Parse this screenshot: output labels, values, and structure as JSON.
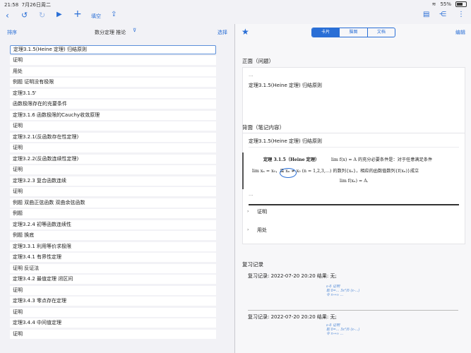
{
  "status": {
    "time": "21:58",
    "date": "7月26日周二",
    "battery": "55%"
  },
  "toolbar": {
    "fill_label": "填空"
  },
  "list_header": {
    "sort": "排序",
    "middle": "数分定理 推论",
    "select": "选择"
  },
  "list_items": [
    "定理3.1.5(Heine 定理) 归结原则",
    "证明",
    "用处",
    "例题 证明没有极限",
    "定理3.1.5'",
    "函数极限存在的充要条件",
    "定理3.1.6 函数极限的Cauchy收敛原理",
    "证明",
    "定理3.2.1(反函数存在性定理)",
    "证明",
    "定理3.2.2(反函数连续性定理)",
    "证明",
    "定理3.2.3 复合函数连续",
    "证明",
    "例题 双曲正弦函数 双曲余弦函数",
    "例题",
    "定理3.2.4 初等函数连续性",
    "例题 换底",
    "定理3.3.1 利用等价求极限",
    "定理3.4.1 有界性定理",
    "证明 反证法",
    "定理3.4.2 最值定理 闭区间",
    "证明",
    "定理3.4.3 零点存在定理",
    "证明",
    "定理3.4.4 中间值定理",
    "证明"
  ],
  "tabs": [
    "卡片",
    "脑图",
    "文档"
  ],
  "edit_label": "编辑",
  "front": {
    "title": "正面（问题）",
    "dots1": "...",
    "text": "定理3.1.5(Heine 定理) 归结原则",
    "dots2": "..."
  },
  "back": {
    "title": "背面（笔记内容）",
    "text": "定理3.1.5(Heine 定理) 归结原则",
    "theorem_line1_label": "定理 3.1.5（Heine 定理）",
    "theorem_line1": "lim f(x) = A 的充分必要条件是：对于任意满足条件",
    "theorem_line2": "lim xₙ = x₀，且 xₙ ≠ x₀ (n = 1,2,3,…) 的数列{xₙ}，相应的函数值数列{f(xₙ)}成立",
    "theorem_line3": "lim f(xₙ) = A.",
    "dots": "...",
    "item1": "证明",
    "item2": "用处"
  },
  "review": {
    "title": "复习记录",
    "entries": [
      {
        "text": "复习记录: 2022-07-20 20:20   结果: 无;"
      },
      {
        "text": "复习记录: 2022-07-20 20:20   结果: 无;"
      }
    ]
  }
}
